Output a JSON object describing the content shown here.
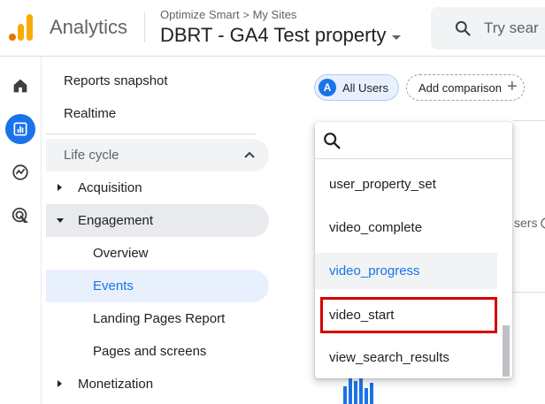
{
  "header": {
    "app_name": "Analytics",
    "breadcrumb_account": "Optimize Smart",
    "breadcrumb_sites": "My Sites",
    "property": "DBRT - GA4 Test property",
    "search_placeholder": "Try sear"
  },
  "rail": {
    "items": [
      {
        "icon": "home-icon"
      },
      {
        "icon": "reports-icon"
      },
      {
        "icon": "explore-icon"
      },
      {
        "icon": "advertising-icon"
      }
    ]
  },
  "nav": {
    "reports_snapshot": "Reports snapshot",
    "realtime": "Realtime",
    "life_cycle": "Life cycle",
    "acquisition": "Acquisition",
    "engagement": "Engagement",
    "overview": "Overview",
    "events": "Events",
    "landing_pages": "Landing Pages Report",
    "pages_and_screens": "Pages and screens",
    "monetization": "Monetization"
  },
  "comparison": {
    "all_users_avatar": "A",
    "all_users": "All Users",
    "add_comparison": "Add comparison",
    "add_icon_glyph": "+"
  },
  "peek": {
    "users_fragment": "sers"
  },
  "dropdown": {
    "items": [
      "user_property_set",
      "video_complete",
      "video_progress",
      "video_start",
      "view_search_results"
    ],
    "hovered": "video_progress",
    "highlighted": "video_start"
  },
  "colors": {
    "accent": "#1a73e8",
    "highlight_border": "#d50000",
    "logo_orange": "#e37400",
    "logo_yellow": "#f9ab00"
  }
}
